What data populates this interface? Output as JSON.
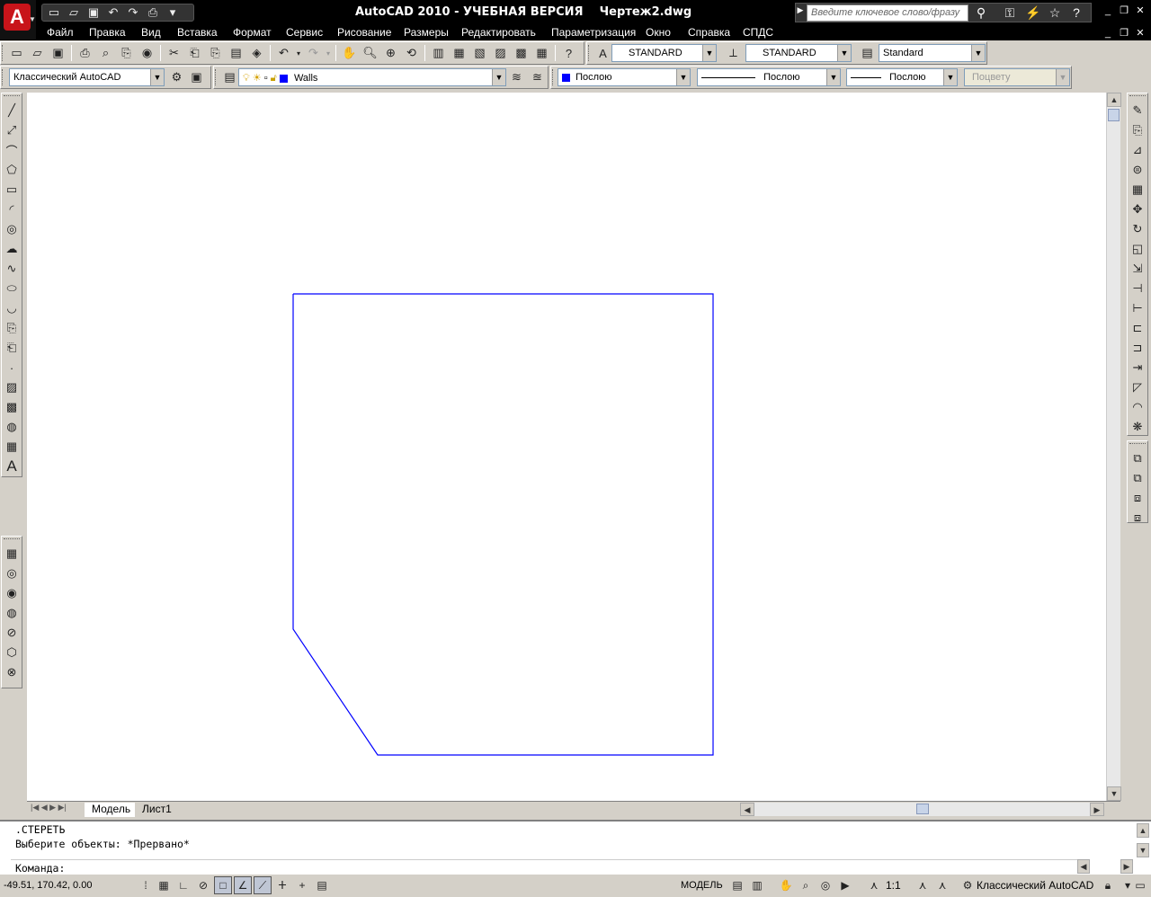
{
  "app": {
    "title": "AutoCAD 2010 - УЧЕБНАЯ ВЕРСИЯ    Чертеж2.dwg"
  },
  "search": {
    "placeholder": "Введите ключевое слово/фразу"
  },
  "menu": [
    "Файл",
    "Правка",
    "Вид",
    "Вставка",
    "Формат",
    "Сервис",
    "Рисование",
    "Размеры",
    "Редактировать",
    "Параметризация",
    "Окно",
    "Справка",
    "СПДС"
  ],
  "styles": {
    "text_style": "STANDARD",
    "dim_style": "STANDARD",
    "table_style": "Standard"
  },
  "workspace": {
    "name": "Классический AutoCAD"
  },
  "layer": {
    "name": "Walls",
    "color": "#0000ff"
  },
  "properties": {
    "color": "Послою",
    "linetype": "Послою",
    "lineweight": "Послою",
    "plotstyle": "Поцвету"
  },
  "drawing": {
    "line_color": "#0000ff"
  },
  "tabs": {
    "model": "Модель",
    "sheet": "Лист1"
  },
  "command": {
    "line1": ".СТЕРЕТЬ",
    "line2": "Выберите объекты: *Прервано*",
    "prompt": "Команда:"
  },
  "status": {
    "coords": "-49.51, 170.42, 0.00",
    "mode": "МОДЕЛЬ",
    "scale": "1:1",
    "workspace": "Классический AutoCAD"
  }
}
